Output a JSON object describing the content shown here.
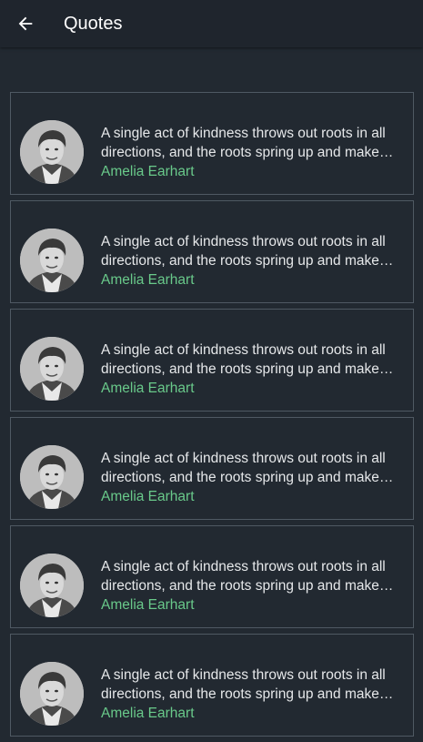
{
  "header": {
    "title": "Quotes",
    "back_icon": "arrow-left-icon"
  },
  "colors": {
    "background": "#222931",
    "app_bar": "#1f252d",
    "card_border": "#4f5963",
    "quote_text": "#e6e8ea",
    "author_text": "#69c98a"
  },
  "quotes": [
    {
      "text": "A single act of kindness throws out roots in all directions, and the roots spring up and make new…",
      "author": "Amelia Earhart"
    },
    {
      "text": "A single act of kindness throws out roots in all directions, and the roots spring up and make new…",
      "author": "Amelia Earhart"
    },
    {
      "text": "A single act of kindness throws out roots in all directions, and the roots spring up and make new…",
      "author": "Amelia Earhart"
    },
    {
      "text": "A single act of kindness throws out roots in all directions, and the roots spring up and make new…",
      "author": "Amelia Earhart"
    },
    {
      "text": "A single act of kindness throws out roots in all directions, and the roots spring up and make new…",
      "author": "Amelia Earhart"
    },
    {
      "text": "A single act of kindness throws out roots in all directions, and the roots spring up and make new…",
      "author": "Amelia Earhart"
    }
  ]
}
